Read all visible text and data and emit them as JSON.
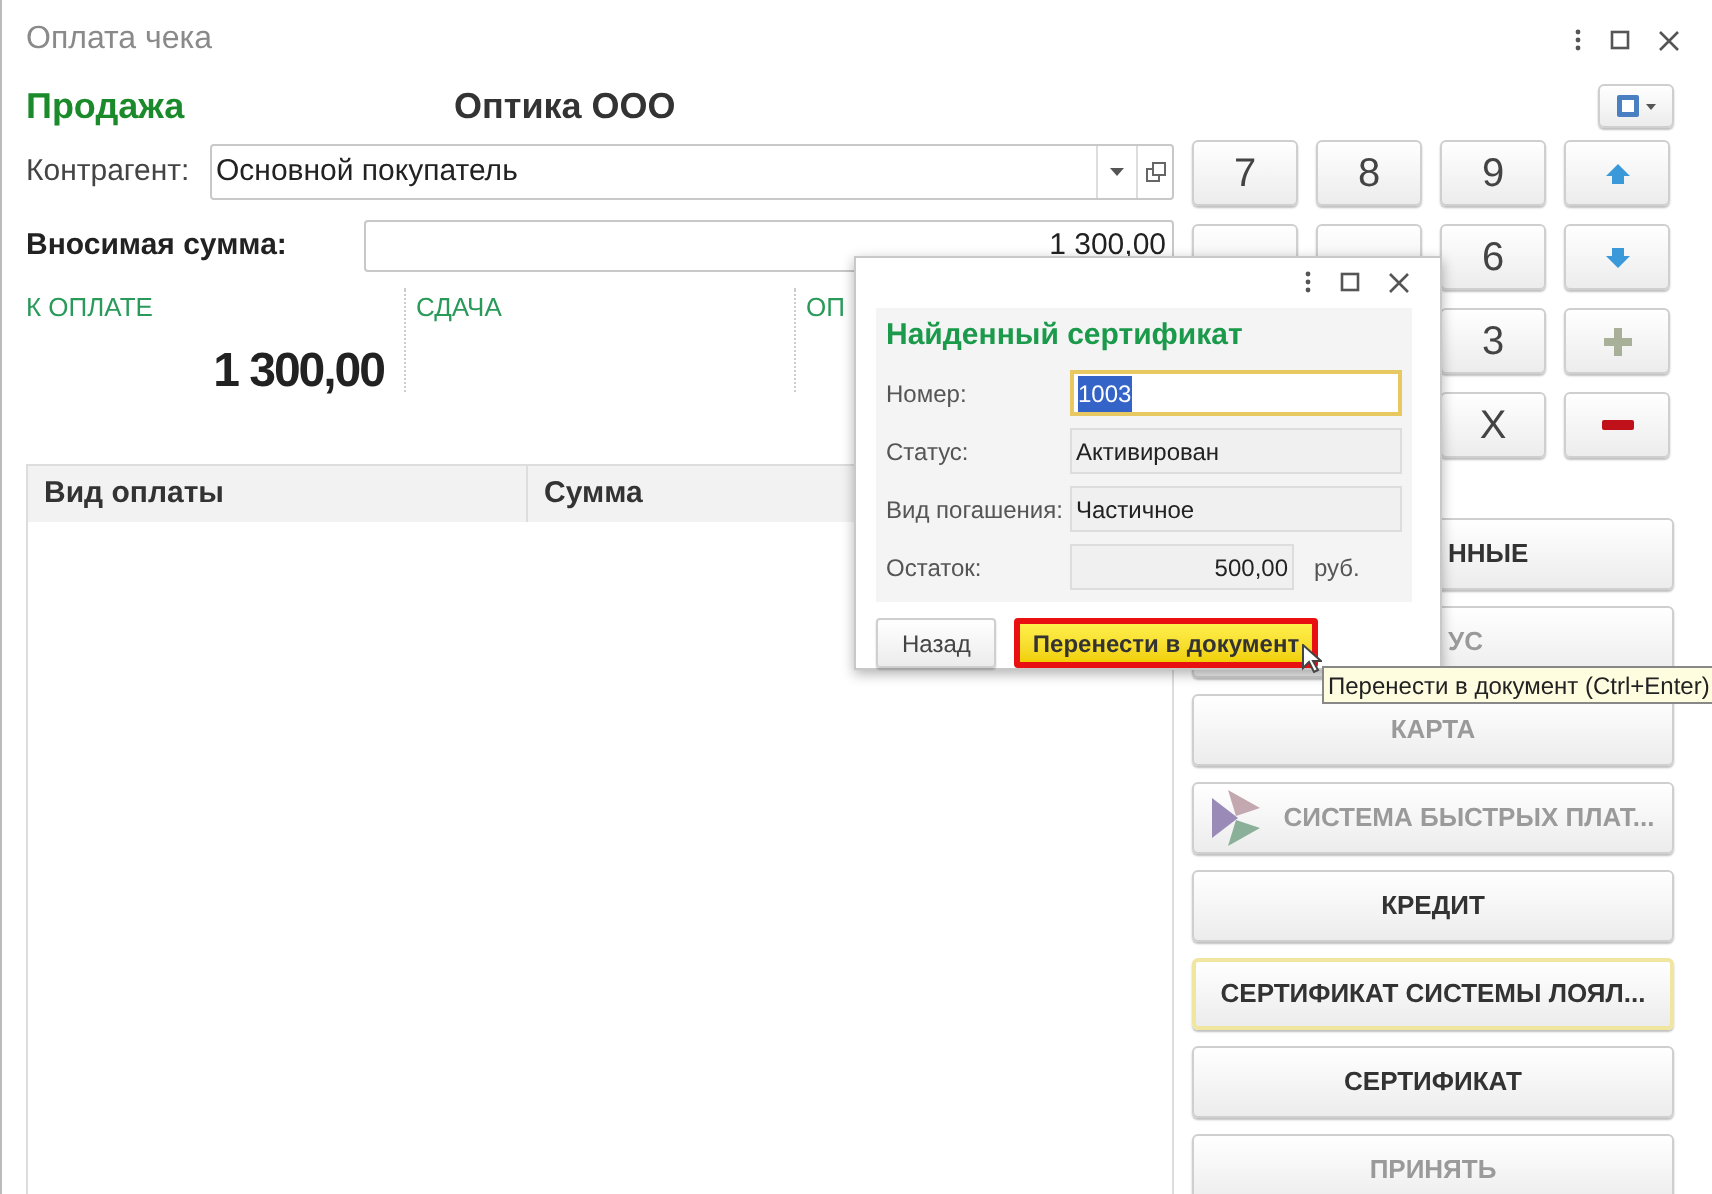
{
  "window": {
    "title": "Оплата чека"
  },
  "header": {
    "operation": "Продажа",
    "organization": "Оптика ООО"
  },
  "counterparty": {
    "label": "Контрагент:",
    "value": "Основной покупатель"
  },
  "amount": {
    "label": "Вносимая сумма:",
    "value": "1 300,00"
  },
  "totals": [
    {
      "label": "К ОПЛАТЕ",
      "value": "1 300,00"
    },
    {
      "label": "СДАЧА"
    },
    {
      "label": "ОП"
    }
  ],
  "payments_table": {
    "columns": [
      "Вид оплаты",
      "Сумма"
    ]
  },
  "keypad": [
    {
      "kind": "key",
      "label": "7"
    },
    {
      "kind": "key",
      "label": "8"
    },
    {
      "kind": "key",
      "label": "9"
    },
    {
      "kind": "up"
    },
    {
      "kind": "covered"
    },
    {
      "kind": "covered"
    },
    {
      "kind": "key",
      "label": "6"
    },
    {
      "kind": "down"
    },
    {
      "kind": "hidden"
    },
    {
      "kind": "hidden"
    },
    {
      "kind": "key",
      "label": "3"
    },
    {
      "kind": "plus"
    },
    {
      "kind": "hidden"
    },
    {
      "kind": "hidden"
    },
    {
      "kind": "key",
      "label": "X"
    },
    {
      "kind": "minus"
    }
  ],
  "payment_buttons": [
    {
      "label": "ННЫЕ",
      "disabled": false,
      "focused": false,
      "covered": true
    },
    {
      "label": "УС",
      "disabled": true,
      "focused": false,
      "covered": true
    },
    {
      "label": "КАРТА",
      "disabled": true,
      "focused": false,
      "covered": false
    },
    {
      "label": "СИСТЕМА БЫСТРЫХ ПЛАТ...",
      "disabled": true,
      "focused": false,
      "covered": false,
      "kind": "icon"
    },
    {
      "label": "КРЕДИТ",
      "disabled": false,
      "focused": false,
      "covered": false
    },
    {
      "label": "СЕРТИФИКАТ СИСТЕМЫ ЛОЯЛ...",
      "disabled": false,
      "focused": true,
      "covered": false
    },
    {
      "label": "СЕРТИФИКАТ",
      "disabled": false,
      "focused": false,
      "covered": false
    },
    {
      "label": "ПРИНЯТЬ",
      "disabled": true,
      "focused": false,
      "covered": false
    }
  ],
  "dialog": {
    "title": "Найденный сертификат",
    "fields": [
      {
        "label": "Номер:",
        "value": "1003",
        "focused": true
      },
      {
        "label": "Статус:",
        "value": "Активирован",
        "focused": false
      },
      {
        "label": "Вид погашения:",
        "value": "Частичное",
        "focused": false
      },
      {
        "label": "Остаток:",
        "value": "500,00",
        "focused": false,
        "unit": "руб."
      }
    ],
    "buttons": [
      {
        "label": "Назад",
        "default": false
      },
      {
        "label": "Перенести в документ",
        "default": true
      }
    ]
  },
  "tooltip": {
    "text": "Перенести в документ (Ctrl+Enter)"
  }
}
